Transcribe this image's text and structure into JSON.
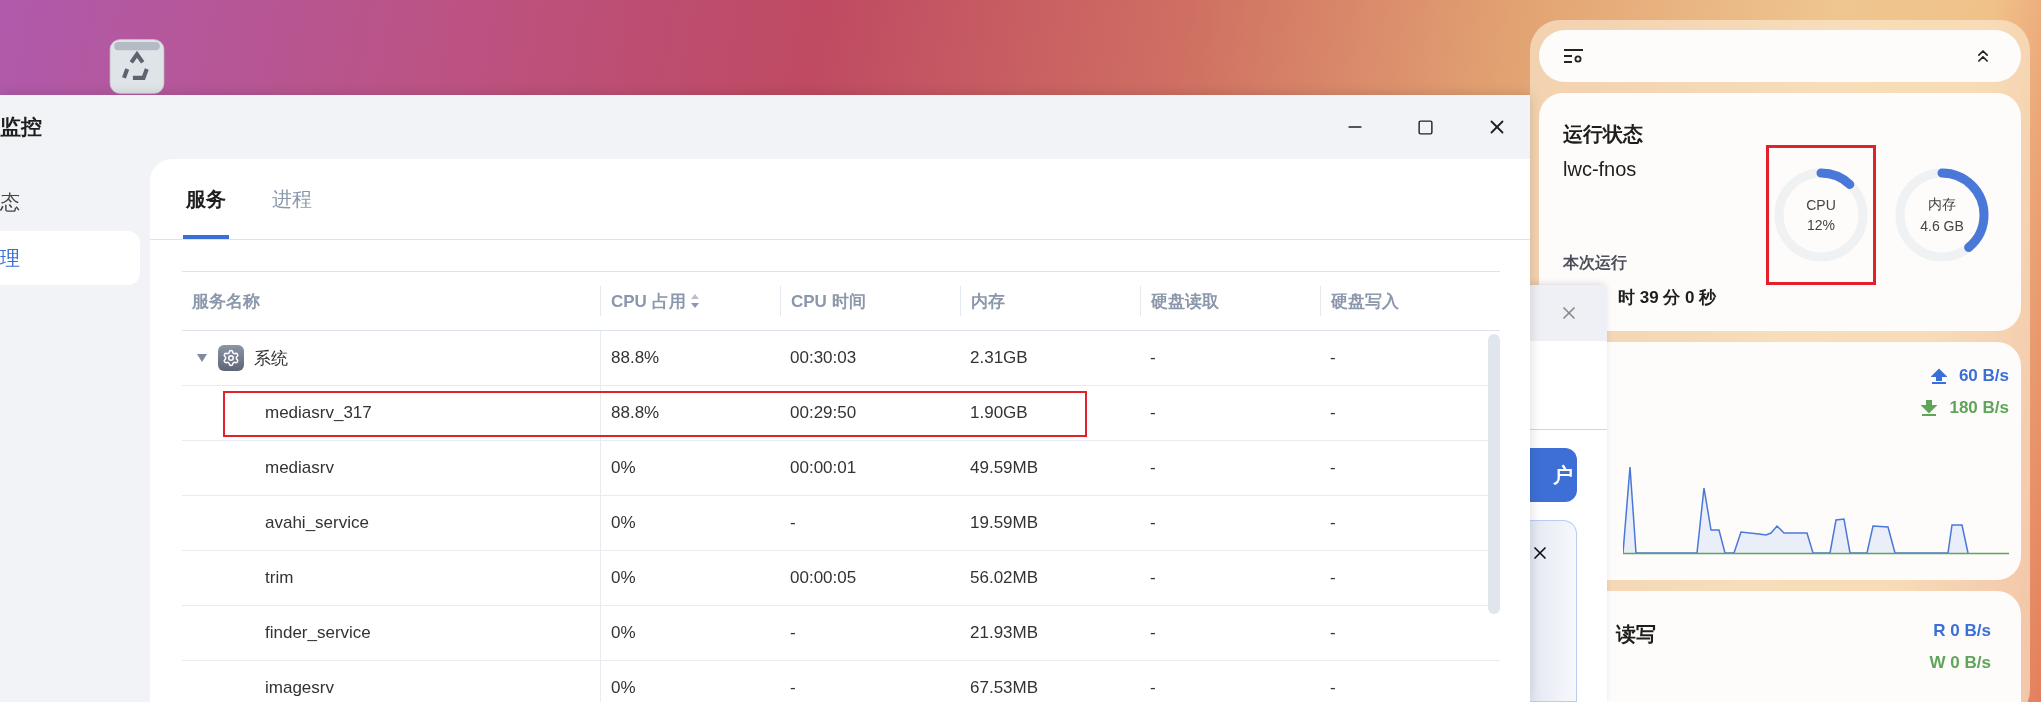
{
  "window": {
    "title": "监控"
  },
  "sidebar": {
    "items": [
      {
        "label": "态",
        "selected": false
      },
      {
        "label": "理",
        "selected": true
      }
    ]
  },
  "tabs": [
    {
      "label": "服务",
      "selected": true
    },
    {
      "label": "进程",
      "selected": false
    }
  ],
  "table": {
    "columns": [
      {
        "label": "服务名称",
        "sortable": false
      },
      {
        "label": "CPU 占用",
        "sortable": true
      },
      {
        "label": "CPU 时间",
        "sortable": false
      },
      {
        "label": "内存",
        "sortable": false
      },
      {
        "label": "硬盘读取",
        "sortable": false
      },
      {
        "label": "硬盘写入",
        "sortable": false
      }
    ],
    "rows": [
      {
        "name": "系统",
        "cpu": "88.8%",
        "cpu_time": "00:30:03",
        "memory": "2.31GB",
        "disk_read": "-",
        "disk_write": "-",
        "expanded": true,
        "highlighted": false,
        "children": [
          {
            "name": "mediasrv_317",
            "cpu": "88.8%",
            "cpu_time": "00:29:50",
            "memory": "1.90GB",
            "disk_read": "-",
            "disk_write": "-",
            "highlighted": true
          },
          {
            "name": "mediasrv",
            "cpu": "0%",
            "cpu_time": "00:00:01",
            "memory": "49.59MB",
            "disk_read": "-",
            "disk_write": "-",
            "highlighted": false
          },
          {
            "name": "avahi_service",
            "cpu": "0%",
            "cpu_time": "-",
            "memory": "19.59MB",
            "disk_read": "-",
            "disk_write": "-",
            "highlighted": false
          },
          {
            "name": "trim",
            "cpu": "0%",
            "cpu_time": "00:00:05",
            "memory": "56.02MB",
            "disk_read": "-",
            "disk_write": "-",
            "highlighted": false
          },
          {
            "name": "finder_service",
            "cpu": "0%",
            "cpu_time": "-",
            "memory": "21.93MB",
            "disk_read": "-",
            "disk_write": "-",
            "highlighted": false
          },
          {
            "name": "imagesrv",
            "cpu": "0%",
            "cpu_time": "-",
            "memory": "67.53MB",
            "disk_read": "-",
            "disk_write": "-",
            "highlighted": false
          }
        ]
      }
    ]
  },
  "background_window": {
    "button": "户"
  },
  "widgets": {
    "status": {
      "title": "运行状态",
      "host": "lwc-fnos",
      "uptime_label": "本次运行",
      "uptime": "时 39 分 0 秒",
      "gauges": [
        {
          "label": "CPU",
          "reading": "12%",
          "level": 0.12,
          "highlighted": true
        },
        {
          "label": "内存",
          "reading": "4.6 GB",
          "level": 0.39,
          "highlighted": false
        }
      ]
    },
    "network": {
      "upload": "60 B/s",
      "download": "180 B/s"
    },
    "disk": {
      "title": "读写",
      "read_label": "R",
      "read": "0 B/s",
      "write_label": "W",
      "write": "0 B/s"
    }
  }
}
